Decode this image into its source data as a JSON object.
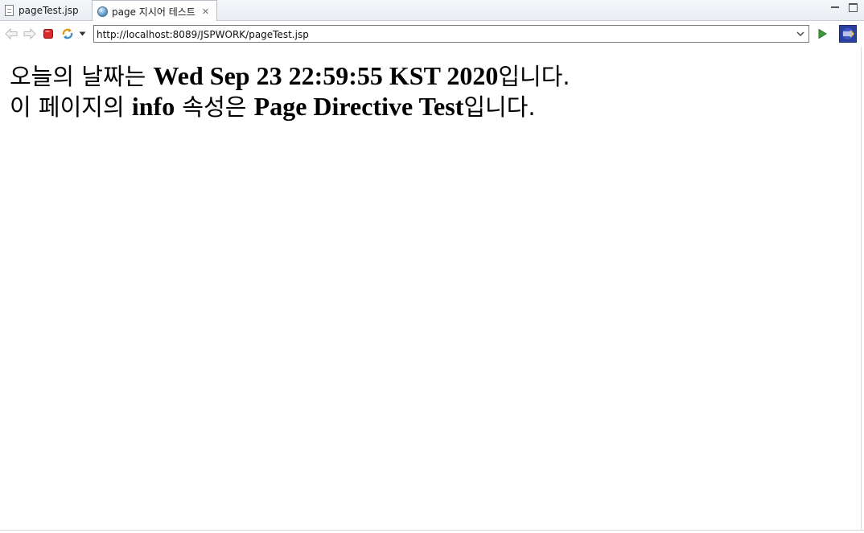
{
  "tabs": [
    {
      "label": "pageTest.jsp"
    },
    {
      "label": "page 지시어 테스트"
    }
  ],
  "toolbar": {
    "url": "http://localhost:8089/JSPWORK/pageTest.jsp"
  },
  "content": {
    "line1": {
      "prefix": "오늘의 날짜는 ",
      "value": "Wed Sep 23 22:59:55 KST 2020",
      "suffix": "입니다."
    },
    "line2": {
      "prefix": "이 페이지의 ",
      "info_word": "info",
      "middle": " 속성은 ",
      "value": "Page Directive Test",
      "suffix": "입니다."
    }
  },
  "colors": {
    "stop_red": "#d92b2b",
    "go_green": "#3a9d3a",
    "tab_bg": "#e9edf2",
    "eclipse_blue": "#2a3f9e"
  }
}
